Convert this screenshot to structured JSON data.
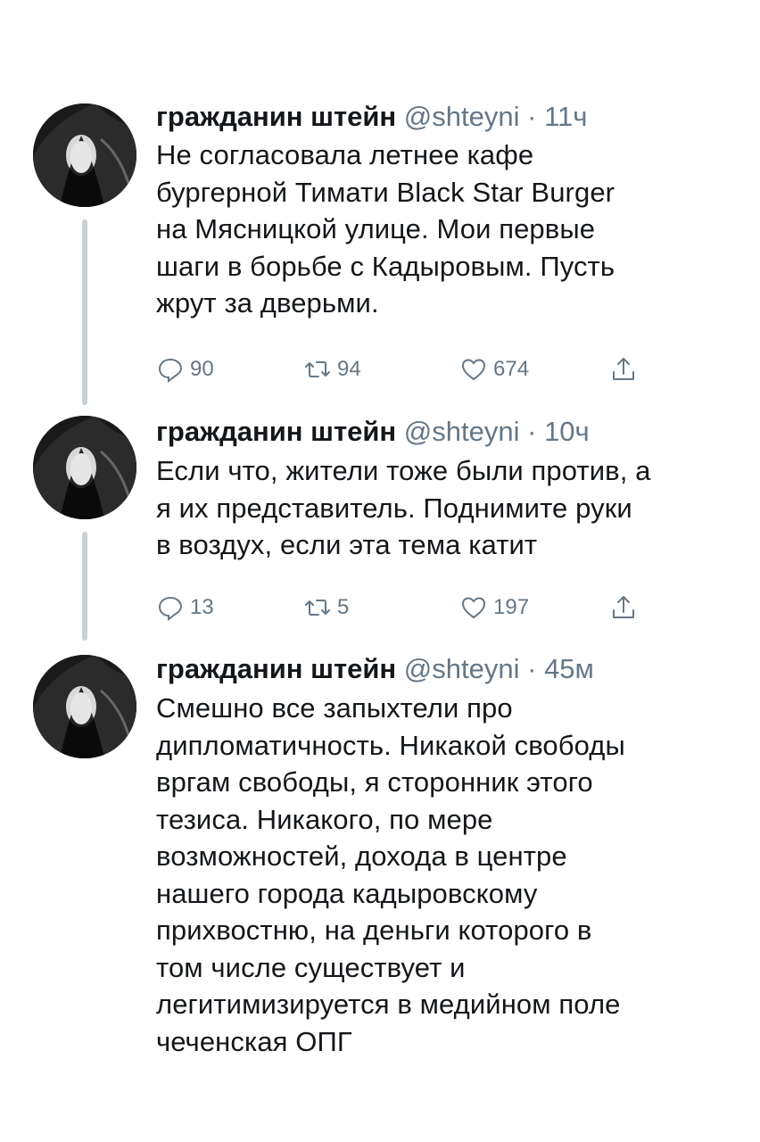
{
  "tweets": [
    {
      "name": "гражданин штейн",
      "handle": "@shteyni",
      "separator": "·",
      "time": "11ч",
      "text": "Не согласовала летнее кафе\nбургерной Тимати Black Star Burger\nна Мясницкой улице. Мои первые\nшаги в борьбе с Кадыровым. Пусть\nжрут за дверьми.",
      "replies": "90",
      "retweets": "94",
      "likes": "674"
    },
    {
      "name": "гражданин штейн",
      "handle": "@shteyni",
      "separator": "·",
      "time": "10ч",
      "text": "Если что, жители тоже были против, а\nя их представитель. Поднимите руки\nв воздух, если эта тема катит",
      "replies": "13",
      "retweets": "5",
      "likes": "197"
    },
    {
      "name": "гражданин штейн",
      "handle": "@shteyni",
      "separator": "·",
      "time": "45м",
      "text": "Смешно все запыхтели про\nдипломатичность. Никакой свободы\nвргам свободы, я сторонник этого\nтезиса. Никакого, по мере\nвозможностей, дохода в центре\nнашего города кадыровскому\nприхвостню, на деньги которого в\nтом числе существует и\nлегитимизируется в медийном поле\nчеченская ОПГ"
    }
  ],
  "icons": {
    "reply": "reply-icon",
    "retweet": "retweet-icon",
    "like": "heart-icon",
    "share": "share-icon"
  },
  "colors": {
    "text": "#14171a",
    "secondary": "#657786",
    "thread_line": "#c8d1d8"
  }
}
